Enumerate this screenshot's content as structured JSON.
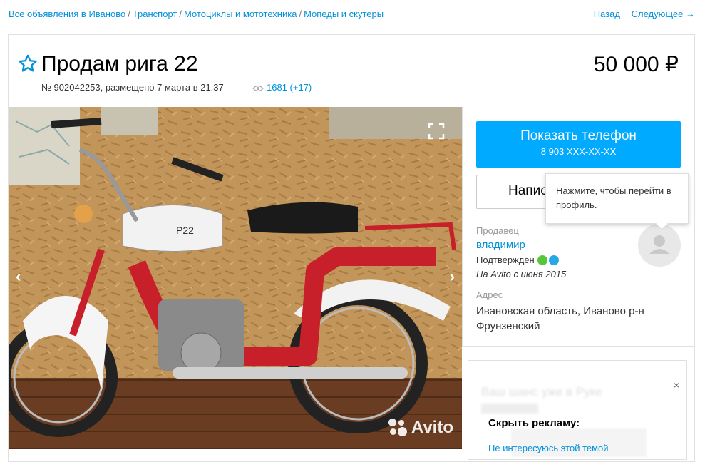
{
  "breadcrumbs": {
    "items": [
      "Все объявления в Иваново",
      "Транспорт",
      "Мотоциклы и мототехника",
      "Мопеды и скутеры"
    ],
    "separator": "/"
  },
  "nav": {
    "back": "Назад",
    "next": "Следующее →"
  },
  "listing": {
    "title": "Продам рига 22",
    "price": "50 000 ₽",
    "meta": "№ 902042253, размещено 7 марта в 21:37",
    "views": "1681 (+17)"
  },
  "gallery": {
    "prev_icon": "chevron-left-icon",
    "next_icon": "chevron-right-icon",
    "fullscreen_icon": "fullscreen-icon",
    "watermark": "Avito"
  },
  "contact": {
    "phone_button_label": "Показать телефон",
    "phone_masked": "8 903 XXX-XX-XX",
    "write_button_label": "Написать",
    "tooltip": "Нажмите, чтобы перейти в профиль."
  },
  "seller": {
    "label": "Продавец",
    "name": "владимир",
    "verified": "Подтверждён",
    "since": "На Avito с июня 2015"
  },
  "address": {
    "label": "Адрес",
    "line1": "Ивановская область, Иваново р-н",
    "line2": "Фрунзенский"
  },
  "ad": {
    "blurred_title": "Ваш шанс уже в Руке",
    "hide_label": "Скрыть рекламу:",
    "reason": "Не интересуюсь этой темой",
    "close": "×"
  },
  "colors": {
    "accent": "#00aaff",
    "link": "#0091d9",
    "phone_ok": "#5ac53a",
    "mail_ok": "#26a8e8"
  }
}
